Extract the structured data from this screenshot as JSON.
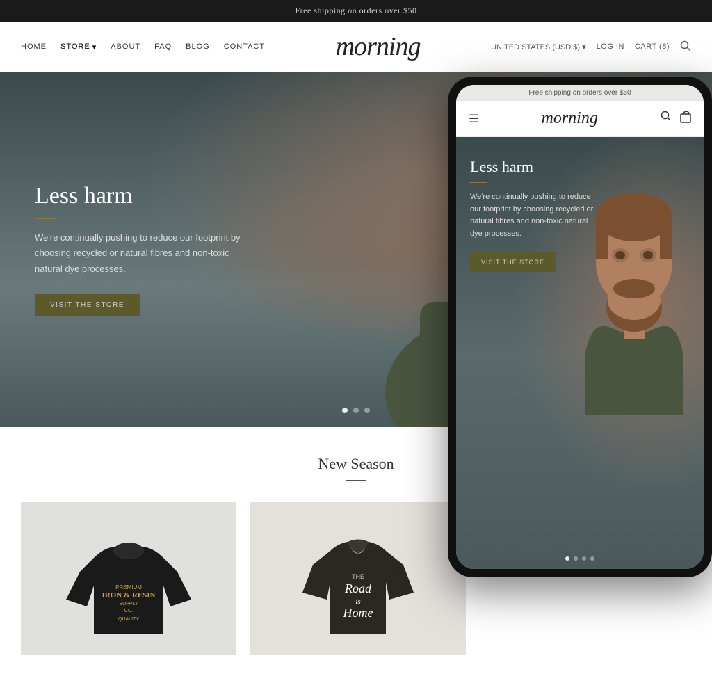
{
  "announcement": {
    "text": "Free shipping on orders over $50"
  },
  "header": {
    "nav": [
      {
        "label": "HOME",
        "id": "home"
      },
      {
        "label": "STORE",
        "id": "store",
        "dropdown": true
      },
      {
        "label": "ABOUT",
        "id": "about"
      },
      {
        "label": "FAQ",
        "id": "faq"
      },
      {
        "label": "BLOG",
        "id": "blog"
      },
      {
        "label": "CONTACT",
        "id": "contact"
      }
    ],
    "logo": "morning",
    "right": {
      "region": "UNITED STATES (USD $)",
      "login": "LOG IN",
      "cart": "CART (8)"
    }
  },
  "hero": {
    "title": "Less harm",
    "description": "We're continually pushing to reduce our footprint by choosing recycled or natural fibres and non-toxic natural dye processes.",
    "button": "VISIT THE STORE",
    "dots": [
      {
        "active": true
      },
      {
        "active": false
      },
      {
        "active": false
      }
    ]
  },
  "new_season": {
    "title": "New Season"
  },
  "phone": {
    "announcement": "Free shipping on orders over $50",
    "logo": "morning",
    "hero": {
      "title": "Less harm",
      "description": "We're continually pushing to reduce our footprint by choosing recycled or natural fibres and non-toxic natural dye processes.",
      "button": "VISIT THE STORE"
    },
    "dots": [
      {
        "active": true
      },
      {
        "active": false
      },
      {
        "active": false
      },
      {
        "active": false
      }
    ]
  },
  "products": [
    {
      "name": "Iron & Resin Sweater",
      "type": "sweater",
      "bg": "#e0e0dc"
    },
    {
      "name": "Road Is Home Tee",
      "type": "tshirt",
      "bg": "#e4e0dc"
    }
  ]
}
